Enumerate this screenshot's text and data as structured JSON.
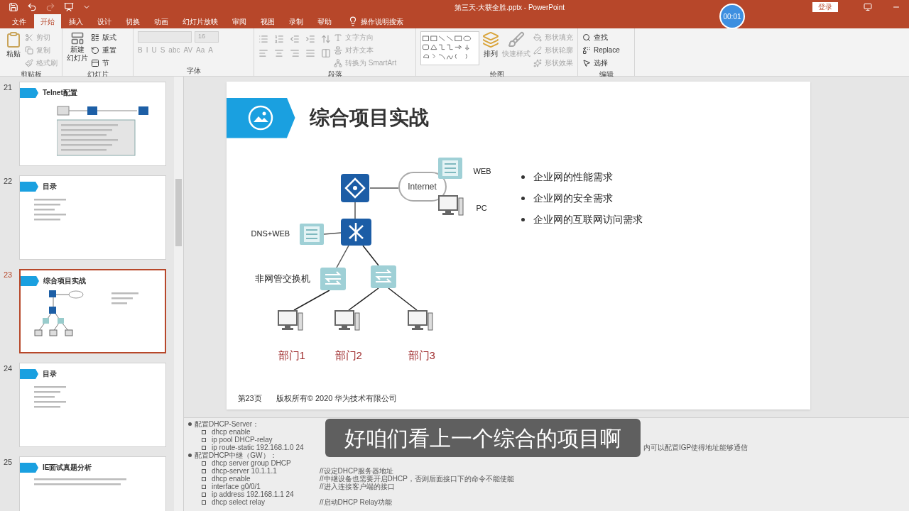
{
  "window": {
    "title": "第三天-大获全胜.pptx  -  PowerPoint",
    "login": "登录",
    "timer": "00:01"
  },
  "quick_access": [
    {
      "kind": "save",
      "disabled": false
    },
    {
      "kind": "undo",
      "disabled": false
    },
    {
      "kind": "redo",
      "disabled": true
    },
    {
      "kind": "present",
      "disabled": false
    }
  ],
  "tabs": [
    {
      "label": "文件",
      "selected": false
    },
    {
      "label": "开始",
      "selected": true
    },
    {
      "label": "插入",
      "selected": false
    },
    {
      "label": "设计",
      "selected": false
    },
    {
      "label": "切换",
      "selected": false
    },
    {
      "label": "动画",
      "selected": false
    },
    {
      "label": "幻灯片放映",
      "selected": false
    },
    {
      "label": "审阅",
      "selected": false
    },
    {
      "label": "视图",
      "selected": false
    },
    {
      "label": "录制",
      "selected": false
    },
    {
      "label": "帮助",
      "selected": false
    }
  ],
  "search": {
    "placeholder": "操作说明搜索"
  },
  "ribbon": {
    "clipboard": {
      "label": "剪贴板",
      "paste": "粘贴",
      "items": [
        {
          "label": "剪切",
          "disabled": true
        },
        {
          "label": "复制",
          "disabled": true
        },
        {
          "label": "格式刷",
          "disabled": true
        }
      ]
    },
    "slides": {
      "label": "幻灯片",
      "new_slide": [
        "新建",
        "幻灯片"
      ],
      "items": [
        {
          "label": "版式"
        },
        {
          "label": "重置"
        },
        {
          "label": "节"
        }
      ]
    },
    "font": {
      "label": "字体",
      "size": "16",
      "disabled": true,
      "format_buttons": [
        "B",
        "I",
        "U",
        "S",
        "abc",
        "AV",
        "Aa",
        "A"
      ]
    },
    "paragraph": {
      "label": "段落",
      "items": [
        {
          "label": "文字方向",
          "disabled": true
        },
        {
          "label": "对齐文本",
          "disabled": true
        },
        {
          "label": "转换为 SmartArt",
          "disabled": true
        }
      ]
    },
    "drawing": {
      "label": "绘图",
      "arrange": "排列",
      "quick_styles": {
        "label": "快速样式",
        "disabled": true
      },
      "items": [
        {
          "label": "形状填充",
          "disabled": true
        },
        {
          "label": "形状轮廓",
          "disabled": true
        },
        {
          "label": "形状效果",
          "disabled": true
        }
      ]
    },
    "editing": {
      "label": "编辑",
      "items": [
        {
          "kind": "find",
          "label": "查找"
        },
        {
          "kind": "replace",
          "label": "Replace"
        },
        {
          "kind": "select",
          "label": "选择"
        }
      ]
    }
  },
  "thumbnails": [
    {
      "number": "21",
      "title": "Telnet配置",
      "selected": false,
      "kind": "diagram"
    },
    {
      "number": "22",
      "title": "目录",
      "selected": false,
      "kind": "list"
    },
    {
      "number": "23",
      "title": "综合项目实战",
      "selected": true,
      "kind": "network"
    },
    {
      "number": "24",
      "title": "目录",
      "selected": false,
      "kind": "list"
    },
    {
      "number": "25",
      "title": "IE面试真题分析",
      "selected": false,
      "kind": "bullets"
    }
  ],
  "slide": {
    "title": "综合项目实战",
    "diagram": {
      "cloud": "Internet",
      "web": "WEB",
      "pc": "PC",
      "dns": "DNS+WEB",
      "switch": "非网管交换机",
      "departments": [
        "部门1",
        "部门2",
        "部门3"
      ]
    },
    "bullets": [
      "企业网的性能需求",
      "企业网的安全需求",
      "企业网的互联网访问需求"
    ],
    "page": "第23页",
    "copyright": "版权所有© 2020 华为技术有限公司"
  },
  "notes": [
    {
      "kind": "bullet",
      "text": "配置DHCP-Server："
    },
    {
      "kind": "sub",
      "text": "dhcp enable"
    },
    {
      "kind": "sub",
      "text": "ip pool DHCP-relay"
    },
    {
      "kind": "sub",
      "text": "ip route-static 192.168.1.0 24",
      "tail": "内可以配置IGP使得地址能够通信"
    },
    {
      "kind": "bullet",
      "text": "配置DHCP中继（GW）："
    },
    {
      "kind": "sub",
      "text": "dhcp server group DHCP"
    },
    {
      "kind": "sub",
      "text": "dhcp-server 10.1.1.1",
      "comment": "//设定DHCP服务器地址"
    },
    {
      "kind": "sub",
      "text": "dhcp enable",
      "comment": "//中继设备也需要开启DHCP，否则后面接口下的命令不能使能"
    },
    {
      "kind": "sub",
      "text": "interface g0/0/1",
      "comment": "//进入连接客户端的接口"
    },
    {
      "kind": "sub",
      "text": "ip address 192.168.1.1 24"
    },
    {
      "kind": "sub",
      "text": "dhcp select relay",
      "comment": "//启动DHCP Relay功能"
    }
  ],
  "subtitle": "好咱们看上一个综合的项目啊"
}
